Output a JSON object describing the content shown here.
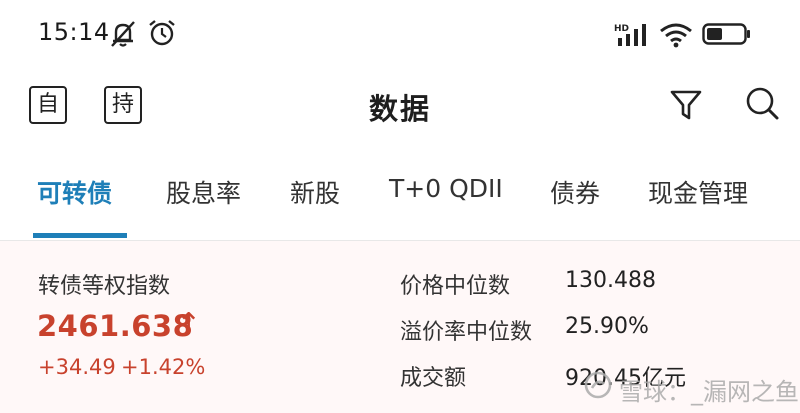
{
  "status_bar": {
    "time": "15:14",
    "network_badge": "HD",
    "icons": [
      "mute-icon",
      "alarm-icon",
      "signal-icon",
      "wifi-icon",
      "battery-icon"
    ]
  },
  "header": {
    "left_button_1": "自",
    "left_button_2": "持",
    "title": "数据",
    "right_icons": [
      "filter-icon",
      "search-icon"
    ]
  },
  "tabs": [
    {
      "label": "可转债",
      "active": true
    },
    {
      "label": "股息率",
      "active": false
    },
    {
      "label": "新股",
      "active": false
    },
    {
      "label": "T+0 QDII",
      "active": false
    },
    {
      "label": "债券",
      "active": false
    },
    {
      "label": "现金管理",
      "active": false
    }
  ],
  "index_panel": {
    "label": "转债等权指数",
    "value": "2461.638",
    "arrow": "↑",
    "change": "+34.49",
    "change_pct": "+1.42%",
    "stats": [
      {
        "label": "价格中位数",
        "value": "130.488"
      },
      {
        "label": "溢价率中位数",
        "value": "25.90%"
      },
      {
        "label": "成交额",
        "value": "920.45亿元"
      }
    ]
  },
  "watermark": {
    "text": "雪球：_漏网之鱼"
  },
  "colors": {
    "accent": "#1e7fb8",
    "up": "#c8422d",
    "panel_bg": "#fff8f8"
  }
}
